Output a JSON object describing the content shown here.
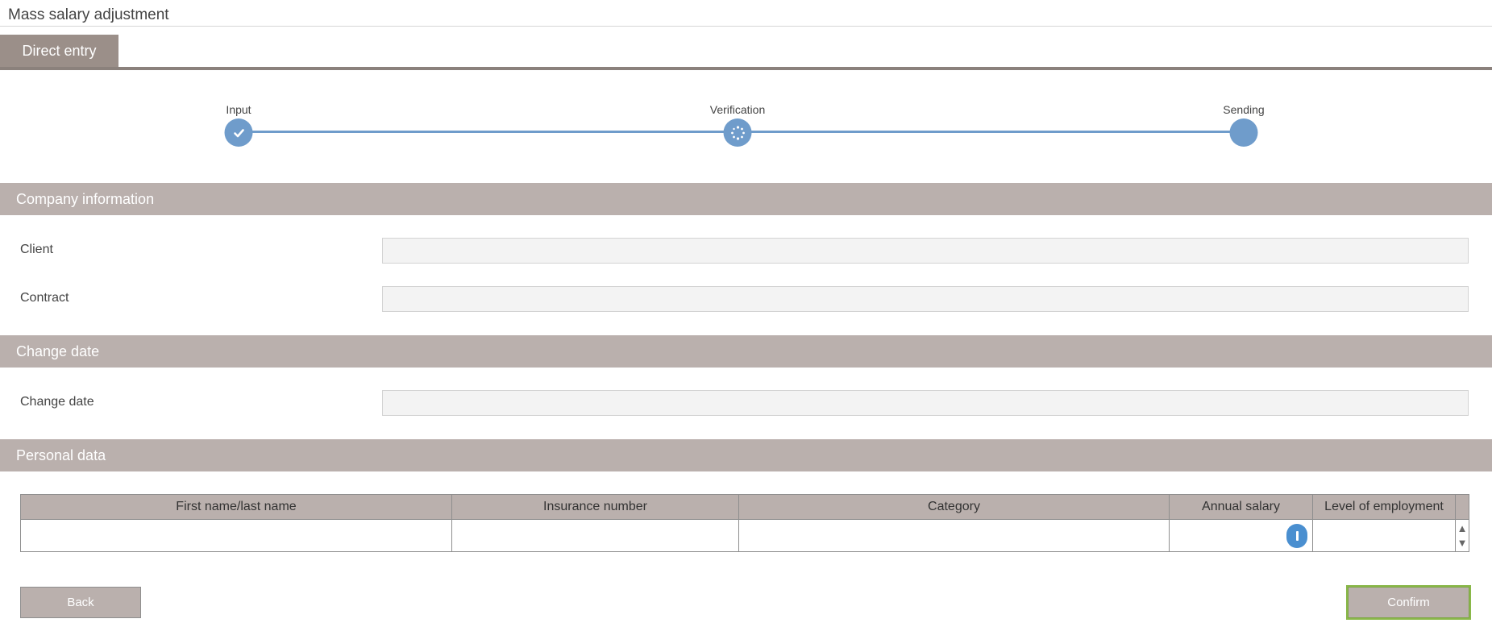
{
  "window": {
    "title": "Mass salary adjustment"
  },
  "tabs": [
    {
      "label": "Direct entry",
      "active": true
    }
  ],
  "stepper": {
    "steps": [
      {
        "label": "Input",
        "state": "done",
        "icon": "checkmark-icon"
      },
      {
        "label": "Verification",
        "state": "in-progress",
        "icon": "spinner-icon"
      },
      {
        "label": "Sending",
        "state": "pending",
        "icon": ""
      }
    ]
  },
  "sections": {
    "company": {
      "title": "Company information"
    },
    "change_date": {
      "title": "Change date"
    },
    "personal": {
      "title": "Personal data"
    }
  },
  "fields": {
    "client": {
      "label": "Client",
      "value": ""
    },
    "contract": {
      "label": "Contract",
      "value": ""
    },
    "change_date": {
      "label": "Change date",
      "value": ""
    }
  },
  "table": {
    "columns": [
      "First name/last name",
      "Insurance number",
      "Category",
      "Annual salary",
      "Level of employment"
    ],
    "rows": [
      {
        "name": "",
        "insurance_number": "",
        "category": "",
        "annual_salary": "",
        "level_of_employment": ""
      }
    ],
    "scroll_up_glyph": "▲",
    "scroll_down_glyph": "▼"
  },
  "buttons": {
    "back": "Back",
    "confirm": "Confirm"
  },
  "colors": {
    "accent": "#6f9ccb",
    "section_header": "#bab0ad",
    "tab": "#9b8f89",
    "info": "#4a8fd0",
    "focus": "#8ab84a"
  }
}
